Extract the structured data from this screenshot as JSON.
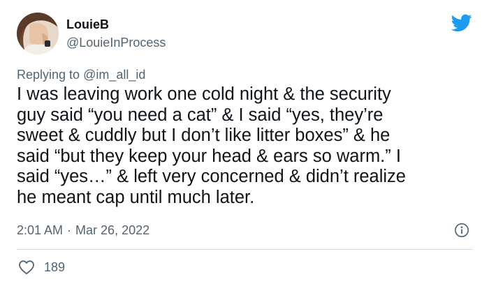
{
  "author": {
    "display_name": "LouieB",
    "handle": "@LouieInProcess"
  },
  "reply": {
    "prefix": "Replying to",
    "mention": "@im_all_id"
  },
  "tweet": {
    "lines": [
      "I was leaving work one cold night & the security",
      "guy said “you need a cat” & I said “yes, they’re",
      "sweet & cuddly but I don’t like litter boxes” & he",
      "said “but they keep your head & ears so warm.” I",
      "said “yes…” & left very concerned & didn’t realize",
      "he meant cap until much later."
    ]
  },
  "meta": {
    "time": "2:01 AM",
    "separator": "·",
    "date": "Mar 26, 2022"
  },
  "engagement": {
    "likes": "189"
  },
  "icons": {
    "brand": "twitter-bird-icon",
    "info": "info-icon",
    "like": "heart-icon"
  },
  "colors": {
    "brand": "#1d9bf0",
    "secondary_text": "#536471",
    "primary_text": "#0f1419",
    "divider": "#cfd9de"
  }
}
